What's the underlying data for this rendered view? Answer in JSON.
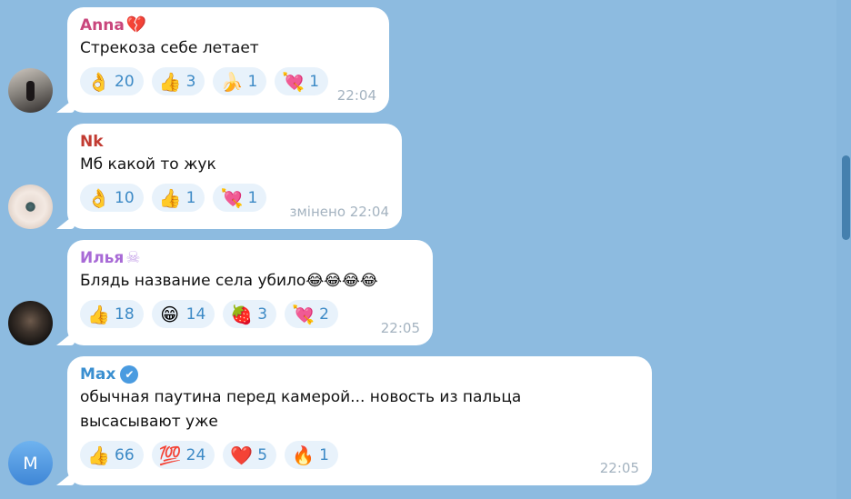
{
  "messages": [
    {
      "author": "Anna",
      "author_color": "#c9467c",
      "author_icon": "💔",
      "text": "Стрекоза себе летает",
      "reactions": [
        {
          "emoji": "👌",
          "count": "20"
        },
        {
          "emoji": "👍",
          "count": "3"
        },
        {
          "emoji": "🍌",
          "count": "1"
        },
        {
          "emoji": "💘",
          "count": "1"
        }
      ],
      "time": "22:04"
    },
    {
      "author": "Nk",
      "author_color": "#c23b32",
      "author_icon": "",
      "text": "Мб какой то жук",
      "reactions": [
        {
          "emoji": "👌",
          "count": "10"
        },
        {
          "emoji": "👍",
          "count": "1"
        },
        {
          "emoji": "💘",
          "count": "1"
        }
      ],
      "time": "змінено 22:04"
    },
    {
      "author": "Илья",
      "author_color": "#a86ad6",
      "author_icon": "☠",
      "text": "Блядь название села убило😂😂😂😂",
      "reactions": [
        {
          "emoji": "👍",
          "count": "18"
        },
        {
          "emoji": "😁",
          "count": "14"
        },
        {
          "emoji": "🍓",
          "count": "3"
        },
        {
          "emoji": "💘",
          "count": "2"
        }
      ],
      "time": "22:05"
    },
    {
      "author": "Max",
      "author_color": "#3a8fd0",
      "author_icon": "✔",
      "text_line1": "обычная паутина перед камерой... новость из пальца",
      "text_line2": "высасывают уже",
      "reactions": [
        {
          "emoji": "👍",
          "count": "66"
        },
        {
          "emoji": "💯",
          "count": "24"
        },
        {
          "emoji": "❤️",
          "count": "5"
        },
        {
          "emoji": "🔥",
          "count": "1"
        }
      ],
      "time": "22:05",
      "avatar_letter": "M"
    }
  ]
}
